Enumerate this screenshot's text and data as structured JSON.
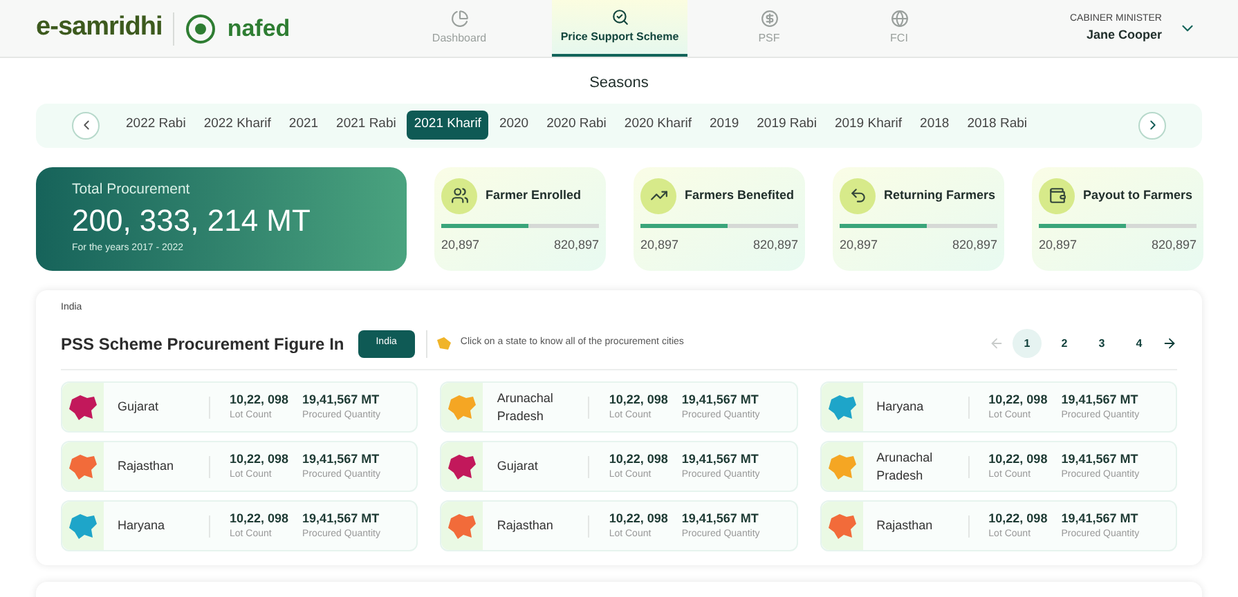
{
  "header": {
    "brand": "e-samridhi",
    "partner_logo": "nafed",
    "nav": [
      {
        "label": "Dashboard",
        "selected": false
      },
      {
        "label": "Price Support Scheme",
        "selected": true
      },
      {
        "label": "PSF",
        "selected": false
      },
      {
        "label": "FCI",
        "selected": false
      }
    ],
    "user": {
      "role": "CABINER MINISTER",
      "name": "Jane Cooper"
    }
  },
  "seasons": {
    "title": "Seasons",
    "items": [
      {
        "label": "2022 Rabi",
        "selected": false
      },
      {
        "label": "2022 Kharif",
        "selected": false
      },
      {
        "label": "2021",
        "selected": false
      },
      {
        "label": "2021 Rabi",
        "selected": false
      },
      {
        "label": "2021 Kharif",
        "selected": true
      },
      {
        "label": "2020",
        "selected": false
      },
      {
        "label": "2020 Rabi",
        "selected": false
      },
      {
        "label": "2020 Kharif",
        "selected": false
      },
      {
        "label": "2019",
        "selected": false
      },
      {
        "label": "2019 Rabi",
        "selected": false
      },
      {
        "label": "2019 Kharif",
        "selected": false
      },
      {
        "label": "2018",
        "selected": false
      },
      {
        "label": "2018 Rabi",
        "selected": false
      }
    ]
  },
  "total": {
    "label": "Total Procurement",
    "value": "200, 333, 214 MT",
    "note": "For the years 2017 - 2022"
  },
  "stats": [
    {
      "kind": "enrolled",
      "title": "Farmer Enrolled",
      "level": 0.55,
      "min": "20,897",
      "max": "820,897"
    },
    {
      "kind": "benefited",
      "title": "Farmers Benefited",
      "level": 0.55,
      "min": "20,897",
      "max": "820,897"
    },
    {
      "kind": "returning",
      "title": "Returning Farmers",
      "level": 0.55,
      "min": "20,897",
      "max": "820,897"
    },
    {
      "kind": "payout",
      "title": "Payout to Farmers",
      "level": 0.55,
      "min": "20,897",
      "max": "820,897"
    }
  ],
  "procurement": {
    "breadcrumb": "India",
    "title": "PSS Scheme Procurement Figure In",
    "region_button": "India",
    "hint": "Click on a state to know all of the procurement cities",
    "pages": [
      {
        "label": "1",
        "selected": true
      },
      {
        "label": "2",
        "selected": false
      },
      {
        "label": "3",
        "selected": false
      },
      {
        "label": "4",
        "selected": false
      }
    ],
    "states": [
      {
        "name": "Gujarat",
        "color": "#c2185b",
        "lot_count": "10,22, 098",
        "lot_label": "Lot Count",
        "quantity": "19,41,567 MT",
        "quantity_label": "Procured Quantity"
      },
      {
        "name": "Arunachal Pradesh",
        "color": "#f5a623",
        "lot_count": "10,22, 098",
        "lot_label": "Lot Count",
        "quantity": "19,41,567 MT",
        "quantity_label": "Procured Quantity"
      },
      {
        "name": "Haryana",
        "color": "#1ea5c9",
        "lot_count": "10,22, 098",
        "lot_label": "Lot Count",
        "quantity": "19,41,567 MT",
        "quantity_label": "Procured Quantity"
      },
      {
        "name": "Rajasthan",
        "color": "#f26b3a",
        "lot_count": "10,22, 098",
        "lot_label": "Lot Count",
        "quantity": "19,41,567 MT",
        "quantity_label": "Procured Quantity"
      },
      {
        "name": "Gujarat",
        "color": "#c2185b",
        "lot_count": "10,22, 098",
        "lot_label": "Lot Count",
        "quantity": "19,41,567 MT",
        "quantity_label": "Procured Quantity"
      },
      {
        "name": "Arunachal Pradesh",
        "color": "#f5a623",
        "lot_count": "10,22, 098",
        "lot_label": "Lot Count",
        "quantity": "19,41,567 MT",
        "quantity_label": "Procured Quantity"
      },
      {
        "name": "Haryana",
        "color": "#1ea5c9",
        "lot_count": "10,22, 098",
        "lot_label": "Lot Count",
        "quantity": "19,41,567 MT",
        "quantity_label": "Procured Quantity"
      },
      {
        "name": "Rajasthan",
        "color": "#f26b3a",
        "lot_count": "10,22, 098",
        "lot_label": "Lot Count",
        "quantity": "19,41,567 MT",
        "quantity_label": "Procured Quantity"
      },
      {
        "name": "Rajasthan",
        "color": "#f26b3a",
        "lot_count": "10,22, 098",
        "lot_label": "Lot Count",
        "quantity": "19,41,567 MT",
        "quantity_label": "Procured Quantity"
      }
    ]
  }
}
